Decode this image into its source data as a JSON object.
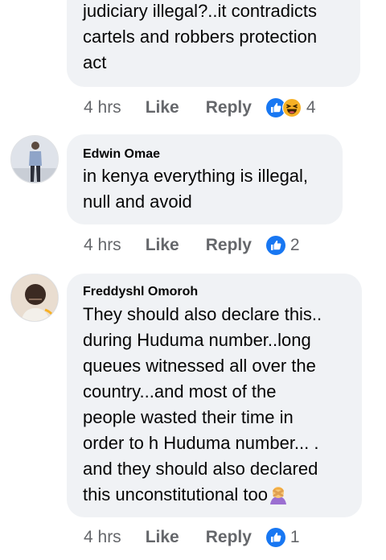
{
  "comments": [
    {
      "author": "",
      "text": "judiciary illegal?..it contradicts\ncartels and robbers protection\nact",
      "time": "4 hrs",
      "like_label": "Like",
      "reply_label": "Reply",
      "reactions": [
        "like-icon",
        "haha-icon"
      ],
      "reaction_count": "4"
    },
    {
      "author": "Edwin Omae",
      "text": "in kenya everything is illegal,\nnull and avoid",
      "time": "4 hrs",
      "like_label": "Like",
      "reply_label": "Reply",
      "reactions": [
        "like-icon"
      ],
      "reaction_count": "2"
    },
    {
      "author": "Freddyshl Omoroh",
      "text": "They should also declare this..\nduring Huduma number..long\nqueues witnessed all over the\ncountry...and most of the\npeople wasted  their time in\norder to h Huduma number... .\nand they should  also declared\nthis unconstitutional too",
      "trailing_emoji": "facepalm-woman-emoji",
      "time": "4 hrs",
      "like_label": "Like",
      "reply_label": "Reply",
      "reactions": [
        "like-icon"
      ],
      "reaction_count": "1"
    }
  ],
  "colors": {
    "bubble": "#f0f2f5",
    "meta_text": "#65676b",
    "like_blue": "#1877f2",
    "haha_yellow": "#f7b125"
  }
}
